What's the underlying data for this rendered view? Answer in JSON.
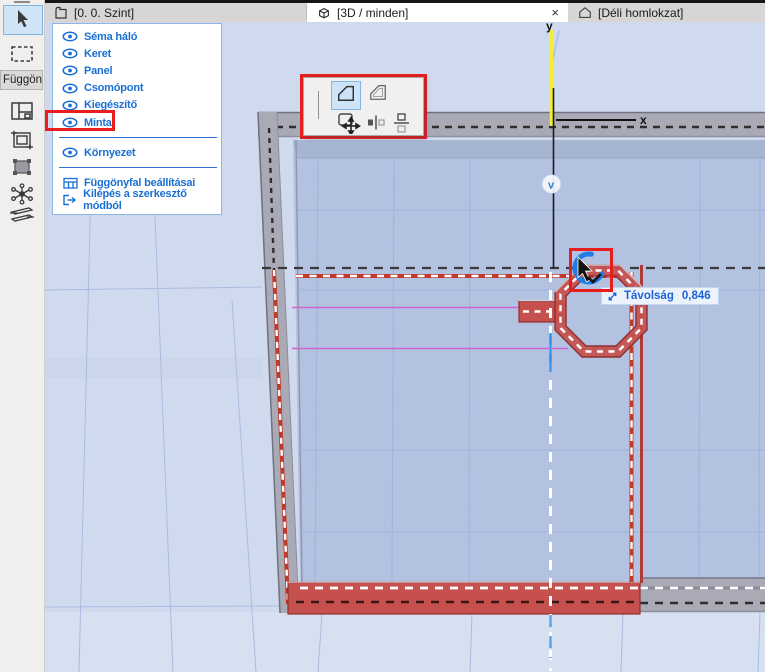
{
  "tabs": {
    "items": [
      {
        "icon": "story-icon",
        "label": "[0. 0. Szint]"
      },
      {
        "icon": "cube-icon",
        "label": "[3D / minden]",
        "close": "×"
      },
      {
        "icon": "elevation-icon",
        "label": "[Déli homlokzat]"
      }
    ]
  },
  "toolbar": {
    "caption": "Függöny",
    "tools": [
      {
        "icon": "arrow-cursor-icon",
        "selected": true
      },
      {
        "icon": "marquee-icon"
      },
      {
        "icon": "scheme-grid-icon"
      },
      {
        "icon": "frame-icon"
      },
      {
        "icon": "panel-icon"
      },
      {
        "icon": "node-icon"
      },
      {
        "icon": "accessory-icon"
      }
    ]
  },
  "context_menu": {
    "items": [
      {
        "icon": "eye-icon",
        "label": "Séma háló"
      },
      {
        "icon": "eye-icon",
        "label": "Keret"
      },
      {
        "icon": "eye-icon",
        "label": "Panel"
      },
      {
        "icon": "eye-icon",
        "label": "Csomópont"
      },
      {
        "icon": "eye-icon",
        "label": "Kiegészítő"
      },
      {
        "icon": "eye-icon",
        "label": "Minta",
        "annotated": true
      },
      {
        "icon": "eye-icon",
        "label": "Környezet"
      },
      {
        "icon": "settings-grid-icon",
        "label": "Függönyfal beállításai"
      },
      {
        "icon": "exit-icon",
        "label": "Kilépés a szerkesztő módból"
      }
    ]
  },
  "pet_palette": {
    "icons": [
      "panel-shape-icon",
      "panel-shape-alt-icon",
      "move-icon",
      "align-icon",
      "distribute-icon"
    ],
    "selected": "panel-shape-icon"
  },
  "scene": {
    "axis_x": "x",
    "axis_y": "y",
    "node_handle": "v",
    "tooltip": {
      "icon": "diagonal-arrows-icon",
      "label": "Távolság",
      "value": "0,846"
    }
  },
  "colors": {
    "annotation_red": "#e81e1e",
    "selection_red": "#c5504e",
    "selection_red_dark": "#8e2f2e",
    "menu_text_blue": "#1a6fd4",
    "tool_selected_bg": "#cfe4f7",
    "facade_glass": "#b2c2e0",
    "frame_gray": "#a9aab6",
    "background_sky": "#d0daee",
    "guide_yellow": "#f4ee33",
    "guide_magenta": "#d45fd4",
    "rotate_arc_blue": "#1e7de6"
  }
}
